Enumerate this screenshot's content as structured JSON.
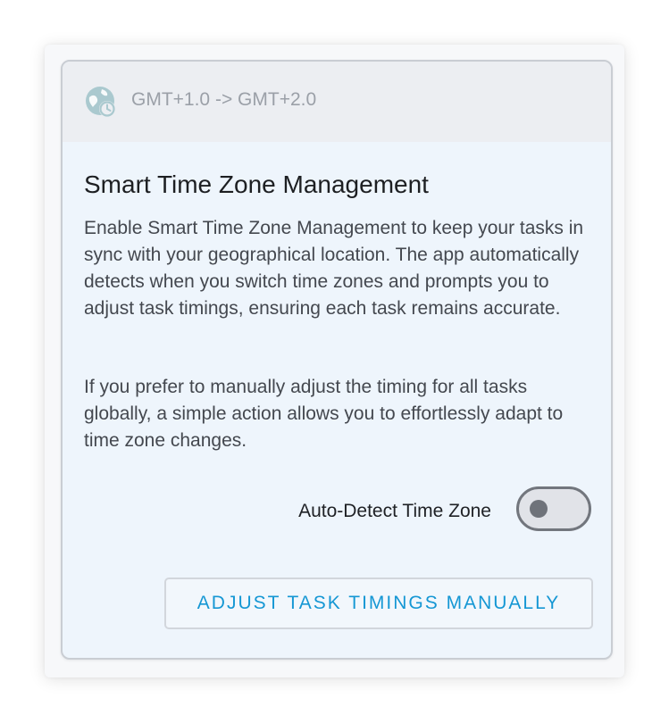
{
  "header": {
    "timezone_change": "GMT+1.0 -> GMT+2.0",
    "icon": "globe-clock-icon"
  },
  "content": {
    "title": "Smart Time Zone Management",
    "paragraph1": "Enable Smart Time Zone Management to keep your tasks in sync with your geographical location. The app automatically detects when you switch time zones and prompts you to adjust task timings, ensuring each task remains accurate.",
    "paragraph2": "If you prefer to manually adjust the timing for all tasks globally, a simple action allows you to effortlessly adapt to time zone changes."
  },
  "toggle": {
    "label": "Auto-Detect Time Zone",
    "checked": false
  },
  "actions": {
    "manual_adjust_label": "ADJUST TASK TIMINGS MANUALLY"
  },
  "colors": {
    "accent": "#1597d4",
    "card_background": "#eef5fc",
    "header_background": "#eceef2",
    "icon_teal": "#aac9cf"
  }
}
